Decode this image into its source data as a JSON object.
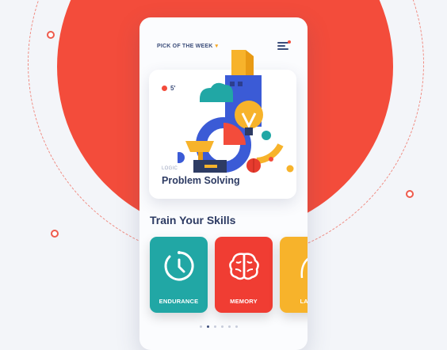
{
  "header": {
    "pick_label": "PICK OF THE WEEK",
    "caret": "▾"
  },
  "card": {
    "duration": "5'",
    "category": "LOGIC",
    "title": "Problem Solving"
  },
  "section": {
    "title": "Train Your Skills"
  },
  "skills": [
    {
      "label": "ENDURANCE",
      "color": "#21a7a5",
      "icon": "stopwatch-icon"
    },
    {
      "label": "MEMORY",
      "color": "#f03d33",
      "icon": "brain-icon"
    },
    {
      "label": "LANG",
      "color": "#f7b32b",
      "icon": "language-icon"
    }
  ],
  "pagination": {
    "count": 6,
    "active": 1
  },
  "colors": {
    "accent": "#f34c3b",
    "navy": "#2d3b63",
    "teal": "#21a7a5",
    "yellow": "#f7b32b"
  }
}
